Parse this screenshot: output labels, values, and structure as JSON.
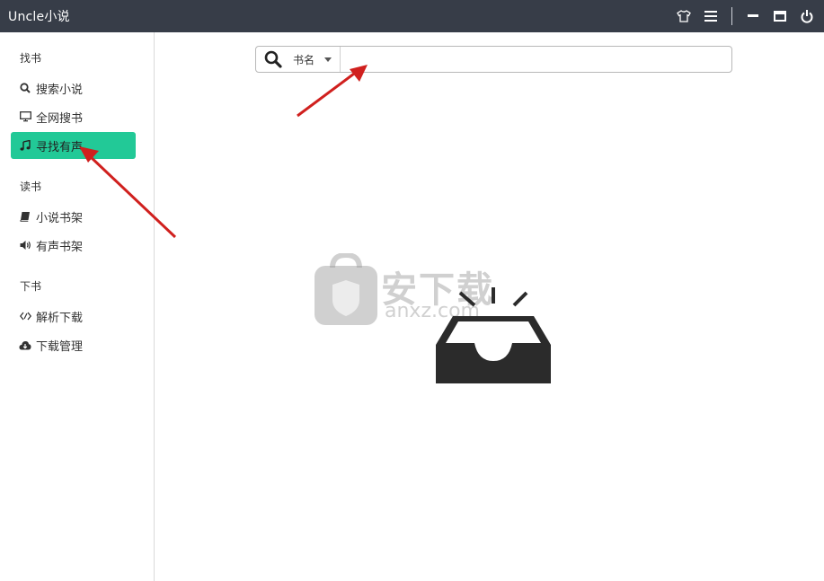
{
  "window": {
    "title": "Uncle小说",
    "controls": [
      "tshirt-icon",
      "menu-icon",
      "minimize-icon",
      "maximize-icon",
      "power-icon"
    ]
  },
  "sidebar": {
    "sections": [
      {
        "title": "找书",
        "items": [
          {
            "label": "搜索小说",
            "icon": "search-icon",
            "active": false
          },
          {
            "label": "全网搜书",
            "icon": "monitor-icon",
            "active": false
          },
          {
            "label": "寻找有声",
            "icon": "music-icon",
            "active": true
          }
        ]
      },
      {
        "title": "读书",
        "items": [
          {
            "label": "小说书架",
            "icon": "book-icon",
            "active": false
          },
          {
            "label": "有声书架",
            "icon": "volume-icon",
            "active": false
          }
        ]
      },
      {
        "title": "下书",
        "items": [
          {
            "label": "解析下载",
            "icon": "code-icon",
            "active": false
          },
          {
            "label": "下载管理",
            "icon": "cloud-download-icon",
            "active": false
          }
        ]
      }
    ]
  },
  "search": {
    "field_selected": "书名",
    "value": "",
    "placeholder": ""
  },
  "watermark": {
    "text": "安下载",
    "sub": "anxz.com"
  },
  "colors": {
    "titlebar": "#373d48",
    "accent": "#22c997",
    "arrow": "#d0201e"
  }
}
